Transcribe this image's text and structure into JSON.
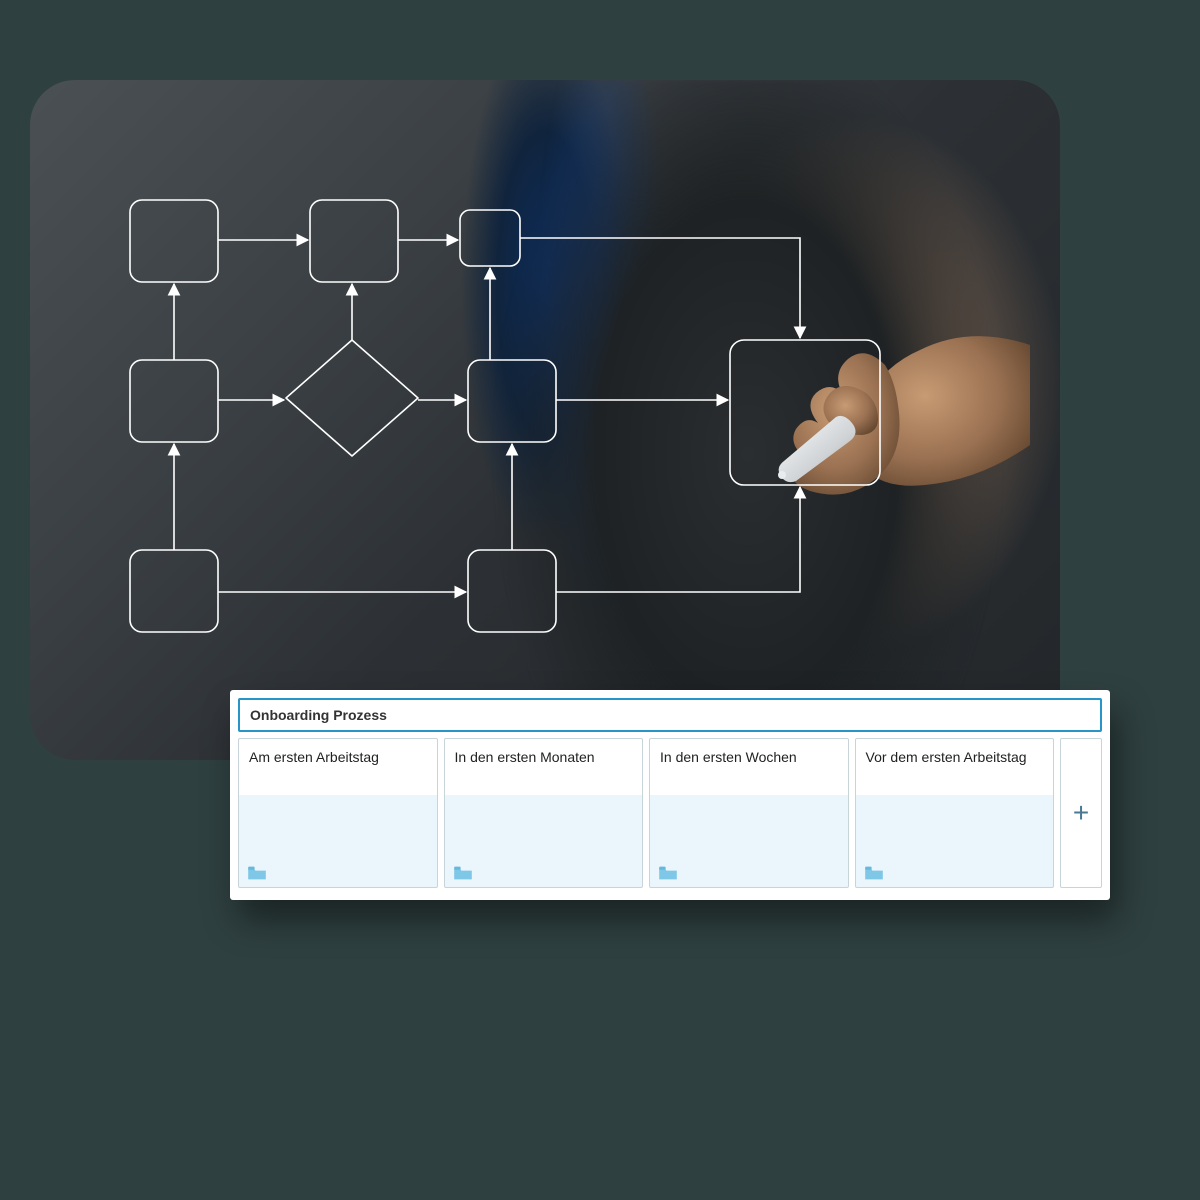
{
  "panel": {
    "title": "Onboarding Prozess",
    "addLabel": "+"
  },
  "cards": [
    {
      "label": "Am ersten Arbeitstag"
    },
    {
      "label": "In den ersten Monaten"
    },
    {
      "label": "In den ersten Wochen"
    },
    {
      "label": "Vor dem ersten Arbeitstag"
    }
  ],
  "colors": {
    "accent": "#2795c7",
    "cardTint": "#eaf6fc",
    "folder": "#7fc7e6"
  }
}
